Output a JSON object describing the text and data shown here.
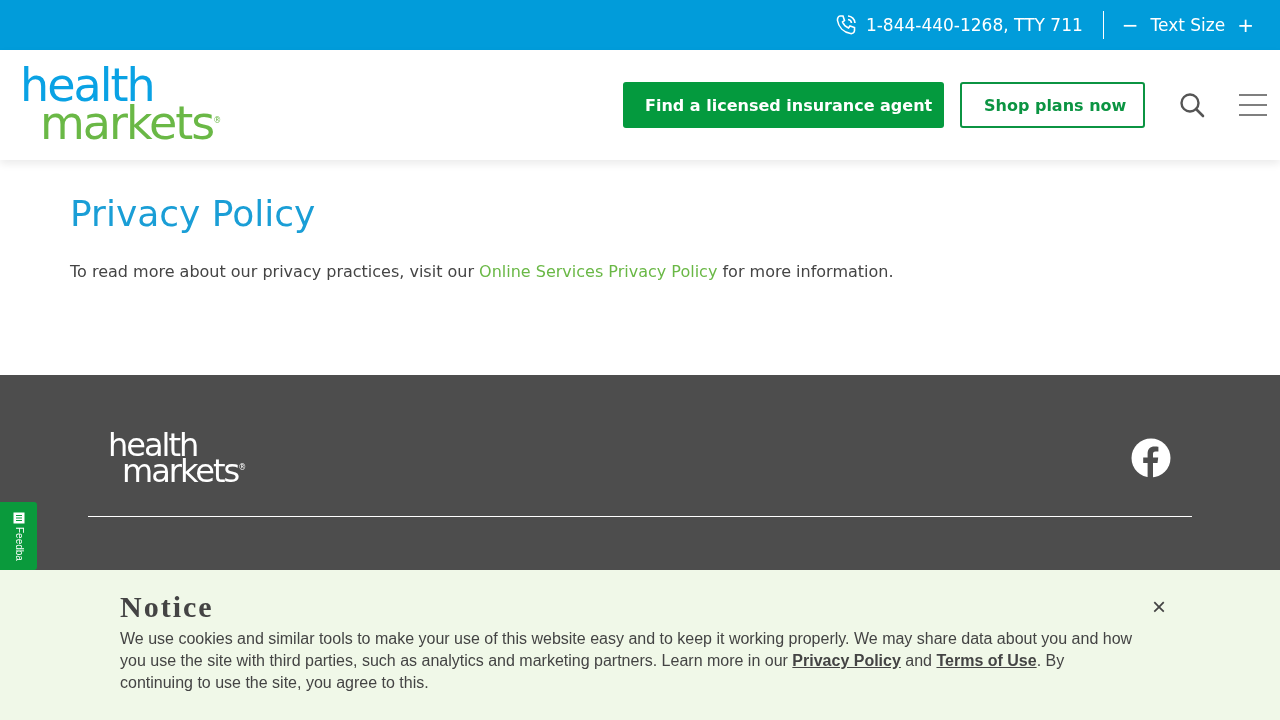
{
  "top_bar": {
    "phone": "1-844-440-1268, TTY 711",
    "text_size": {
      "decrease": "−",
      "label": "Text Size",
      "increase": "+"
    }
  },
  "header": {
    "logo": {
      "line_1": "health",
      "line_2": "markets",
      "mark": "®"
    },
    "buttons": [
      {
        "label": "Find a licensed insurance agent",
        "kind": "primary"
      },
      {
        "label": "Shop plans now",
        "kind": "outline"
      }
    ]
  },
  "main": {
    "title": "Privacy Policy",
    "paragraph": {
      "before": "To read more about our privacy practices, visit our ",
      "link": "Online Services Privacy Policy",
      "after": " for more information."
    }
  },
  "footer": {
    "logo": {
      "line_1": "health",
      "line_2": "markets",
      "mark": "®"
    }
  },
  "feedback_tab": {
    "label": "Feedba"
  },
  "notice": {
    "title": "Notice",
    "close": "×",
    "text": "We use cookies and similar tools to make your use of this website easy and to keep it working properly. We may share data about you and how you use the site with third parties, such as analytics and marketing partners. Learn more in our ",
    "links": [
      "Privacy Policy",
      "Terms of Use"
    ],
    "joiner": " and ",
    "ending": ". By continuing to use the site, you agree to this."
  }
}
